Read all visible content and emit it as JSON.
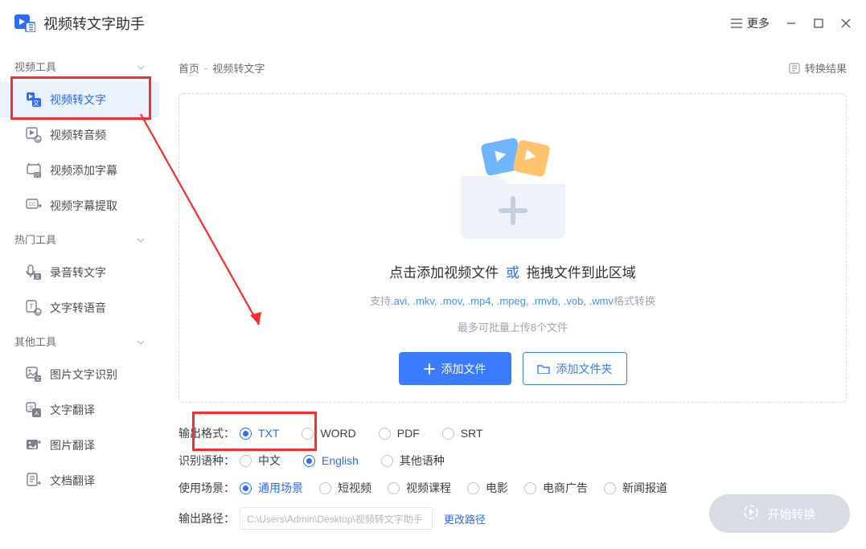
{
  "app": {
    "title": "视频转文字助手",
    "more_label": "更多"
  },
  "breadcrumb": {
    "home": "首页",
    "current": "视频转文字"
  },
  "result_link": "转换结果",
  "sidebar": {
    "groups": [
      {
        "title": "视频工具",
        "items": [
          {
            "label": "视频转文字",
            "active": true
          },
          {
            "label": "视频转音频"
          },
          {
            "label": "视频添加字幕"
          },
          {
            "label": "视频字幕提取"
          }
        ]
      },
      {
        "title": "热门工具",
        "items": [
          {
            "label": "录音转文字"
          },
          {
            "label": "文字转语音"
          }
        ]
      },
      {
        "title": "其他工具",
        "items": [
          {
            "label": "图片文字识别"
          },
          {
            "label": "文字翻译"
          },
          {
            "label": "图片翻译"
          },
          {
            "label": "文档翻译"
          }
        ]
      }
    ]
  },
  "dropzone": {
    "title_pre": "点击添加视频文件",
    "title_or": "或",
    "title_post": "拖拽文件到此区域",
    "formats_pre": "支持",
    "formats": ".avi, .mkv, .mov, .mp4, .mpeg, .rmvb, .vob, .wmv",
    "formats_post": "格式转换",
    "max": "最多可批量上传8个文件",
    "add_file": "添加文件",
    "add_folder": "添加文件夹"
  },
  "options": {
    "out_format_label": "输出格式：",
    "out_formats": [
      "TXT",
      "WORD",
      "PDF",
      "SRT"
    ],
    "out_format_selected": 0,
    "lang_label": "识别语种：",
    "langs": [
      "中文",
      "English",
      "其他语种"
    ],
    "lang_selected": 1,
    "scene_label": "使用场景：",
    "scenes": [
      "通用场景",
      "短视频",
      "视频课程",
      "电影",
      "电商广告",
      "新闻报道"
    ],
    "scene_selected": 0,
    "path_label": "输出路径：",
    "path_value": "C:\\Users\\Admin\\Desktop\\视频转文字助手",
    "change_path": "更改路径"
  },
  "convert_label": "开始转换"
}
